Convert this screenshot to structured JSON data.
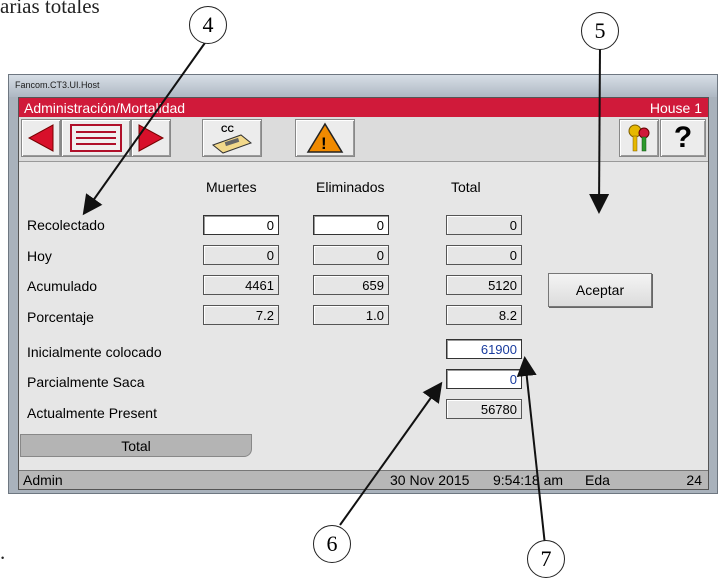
{
  "document": {
    "top_text": "arias totales",
    "bottom_text": "."
  },
  "callouts": [
    "4",
    "5",
    "6",
    "7"
  ],
  "window": {
    "title": "Fancom.CT3.UI.Host"
  },
  "app": {
    "header_left": "Administración/Mortalidad",
    "header_right": "House 1"
  },
  "toolbar": {
    "icons": [
      "arrow-left-icon",
      "list-icon",
      "arrow-right-icon",
      "cc-card-icon",
      "warning-icon",
      "keys-icon",
      "help-icon"
    ],
    "cc_label": "CC",
    "warning_label": "!",
    "help_label": "?"
  },
  "table": {
    "headers": [
      "Muertes",
      "Eliminados",
      "Total"
    ],
    "rows": [
      {
        "label": "Recolectado",
        "values": [
          "0",
          "0",
          "0"
        ]
      },
      {
        "label": "Hoy",
        "values": [
          "0",
          "0",
          "0"
        ]
      },
      {
        "label": "Acumulado",
        "values": [
          "4461",
          "659",
          "5120"
        ]
      },
      {
        "label": "Porcentaje",
        "values": [
          "7.2",
          "1.0",
          "8.2"
        ]
      }
    ]
  },
  "summary": [
    {
      "label": "Inicialmente colocado",
      "value": "61900"
    },
    {
      "label": "Parcialmente Saca",
      "value": "0"
    },
    {
      "label": "Actualmente Present",
      "value": "56780"
    }
  ],
  "accept_label": "Aceptar",
  "tab_label": "Total",
  "status": {
    "user": "Admin",
    "date": "30 Nov 2015",
    "time": "9:54:18 am",
    "age_label": "Eda",
    "age_value": "24"
  },
  "colors": {
    "header_bar": "#d01a3a",
    "arrow_red": "#d8102a",
    "warning_orange": "#f08a00"
  }
}
